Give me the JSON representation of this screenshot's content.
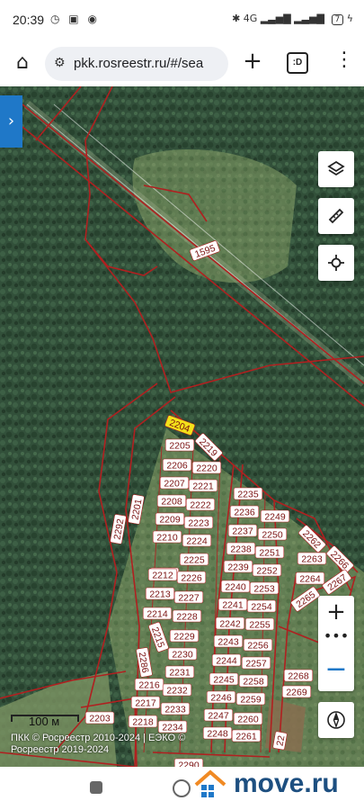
{
  "status_bar": {
    "time": "20:39",
    "signal_label": "4G",
    "battery": "7"
  },
  "browser": {
    "url": "pkk.rosreestr.ru/#/sea",
    "tabs_icon_label": ":D"
  },
  "map": {
    "scale_label": "100 м",
    "copyright_line1": "ПКК © Росреестр 2010-2024 | ЕЭКО ©",
    "copyright_line2": "Росреестр 2019-2024",
    "selected_parcel": "2204",
    "parcel_labels": [
      {
        "text": "1595",
        "highlight": false
      },
      {
        "text": "2204",
        "highlight": true
      },
      {
        "text": "2205",
        "highlight": false
      },
      {
        "text": "2219",
        "highlight": false
      },
      {
        "text": "2206",
        "highlight": false
      },
      {
        "text": "2220",
        "highlight": false
      },
      {
        "text": "2207",
        "highlight": false
      },
      {
        "text": "2221",
        "highlight": false
      },
      {
        "text": "2208",
        "highlight": false
      },
      {
        "text": "2222",
        "highlight": false
      },
      {
        "text": "2209",
        "highlight": false
      },
      {
        "text": "2223",
        "highlight": false
      },
      {
        "text": "2210",
        "highlight": false
      },
      {
        "text": "2224",
        "highlight": false
      },
      {
        "text": "2211",
        "highlight": false
      },
      {
        "text": "2225",
        "highlight": false
      },
      {
        "text": "2212",
        "highlight": false
      },
      {
        "text": "2226",
        "highlight": false
      },
      {
        "text": "2213",
        "highlight": false
      },
      {
        "text": "2227",
        "highlight": false
      },
      {
        "text": "2214",
        "highlight": false
      },
      {
        "text": "2228",
        "highlight": false
      },
      {
        "text": "2215",
        "highlight": false
      },
      {
        "text": "2229",
        "highlight": false
      },
      {
        "text": "2230",
        "highlight": false
      },
      {
        "text": "2231",
        "highlight": false
      },
      {
        "text": "2216",
        "highlight": false
      },
      {
        "text": "2232",
        "highlight": false
      },
      {
        "text": "2217",
        "highlight": false
      },
      {
        "text": "2233",
        "highlight": false
      },
      {
        "text": "2218",
        "highlight": false
      },
      {
        "text": "2234",
        "highlight": false
      },
      {
        "text": "2286",
        "highlight": false
      },
      {
        "text": "2292",
        "highlight": false
      },
      {
        "text": "2201",
        "highlight": false
      },
      {
        "text": "2203",
        "highlight": false
      },
      {
        "text": "2235",
        "highlight": false
      },
      {
        "text": "2236",
        "highlight": false
      },
      {
        "text": "2249",
        "highlight": false
      },
      {
        "text": "2237",
        "highlight": false
      },
      {
        "text": "2250",
        "highlight": false
      },
      {
        "text": "2238",
        "highlight": false
      },
      {
        "text": "2251",
        "highlight": false
      },
      {
        "text": "2239",
        "highlight": false
      },
      {
        "text": "2252",
        "highlight": false
      },
      {
        "text": "2240",
        "highlight": false
      },
      {
        "text": "2253",
        "highlight": false
      },
      {
        "text": "2241",
        "highlight": false
      },
      {
        "text": "2254",
        "highlight": false
      },
      {
        "text": "2242",
        "highlight": false
      },
      {
        "text": "2255",
        "highlight": false
      },
      {
        "text": "2243",
        "highlight": false
      },
      {
        "text": "2256",
        "highlight": false
      },
      {
        "text": "2244",
        "highlight": false
      },
      {
        "text": "2257",
        "highlight": false
      },
      {
        "text": "2245",
        "highlight": false
      },
      {
        "text": "2258",
        "highlight": false
      },
      {
        "text": "2246",
        "highlight": false
      },
      {
        "text": "2259",
        "highlight": false
      },
      {
        "text": "2247",
        "highlight": false
      },
      {
        "text": "2260",
        "highlight": false
      },
      {
        "text": "2248",
        "highlight": false
      },
      {
        "text": "2261",
        "highlight": false
      },
      {
        "text": "2262",
        "highlight": false
      },
      {
        "text": "2266",
        "highlight": false
      },
      {
        "text": "2263",
        "highlight": false
      },
      {
        "text": "2264",
        "highlight": false
      },
      {
        "text": "2267",
        "highlight": false
      },
      {
        "text": "2265",
        "highlight": false
      },
      {
        "text": "2268",
        "highlight": false
      },
      {
        "text": "2269",
        "highlight": false
      },
      {
        "text": "2290",
        "highlight": false
      },
      {
        "text": "22",
        "highlight": false
      }
    ]
  },
  "watermark": {
    "text": "move.ru"
  },
  "colors": {
    "boundary": "#b02020",
    "highlight": "#f2e21a",
    "accent": "#1f78c8",
    "forest": "#2f4a35"
  },
  "icons": {
    "side_panel": "chevron-right-icon",
    "layers": "layers-icon",
    "measure": "ruler-icon",
    "locate": "crosshair-icon",
    "compass": "compass-icon"
  }
}
